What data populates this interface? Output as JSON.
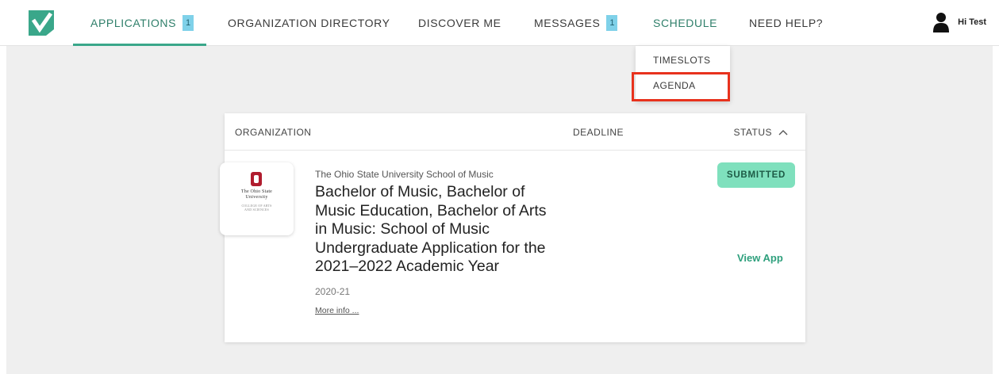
{
  "nav": {
    "items": [
      {
        "label": "APPLICATIONS",
        "badge": "1"
      },
      {
        "label": "ORGANIZATION DIRECTORY"
      },
      {
        "label": "DISCOVER ME"
      },
      {
        "label": "MESSAGES",
        "badge": "1"
      },
      {
        "label": "SCHEDULE"
      },
      {
        "label": "NEED HELP?"
      }
    ],
    "user_greeting": "Hi Test"
  },
  "schedule_menu": {
    "items": [
      "TIMESLOTS",
      "AGENDA"
    ],
    "highlighted": "AGENDA"
  },
  "table": {
    "headers": {
      "organization": "ORGANIZATION",
      "deadline": "DEADLINE",
      "status": "STATUS"
    },
    "rows": [
      {
        "logo_text": [
          "The Ohio State",
          "University",
          "COLLEGE OF ARTS",
          "AND SCIENCES"
        ],
        "organization": "The Ohio State University School of Music",
        "program": "Bachelor of Music, Bachelor of Music Education, Bachelor of Arts in Music: School of Music Undergraduate Application for the 2021–2022 Academic Year",
        "year": "2020-21",
        "more_info": "More info ...",
        "status": "SUBMITTED",
        "action": "View App"
      }
    ]
  },
  "colors": {
    "brand_green": "#3aa78a",
    "badge_blue": "#7fd1e9",
    "status_green": "#7fe0bd",
    "highlight_red": "#e8321d"
  },
  "icons": [
    "checkmark-logo-icon",
    "user-silhouette-icon",
    "chevron-up-icon"
  ]
}
